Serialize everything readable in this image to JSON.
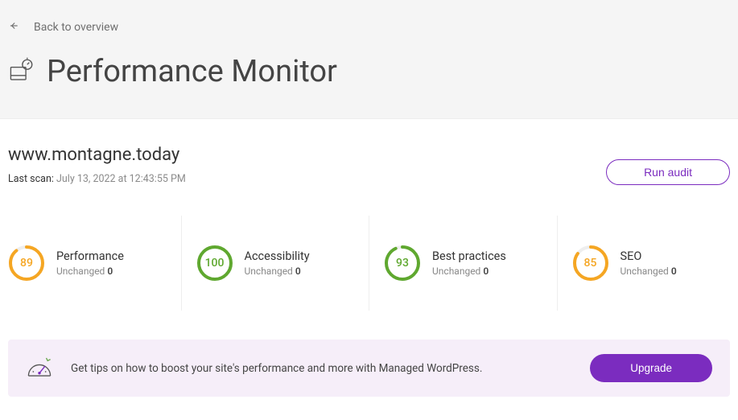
{
  "nav": {
    "back_label": "Back to overview"
  },
  "page_title": "Performance Monitor",
  "site": {
    "name": "www.montagne.today",
    "last_scan_label": "Last scan:",
    "last_scan_value": "July 13, 2022 at 12:43:55 PM",
    "run_audit_label": "Run audit"
  },
  "metrics": [
    {
      "name": "Performance",
      "score": 89,
      "delta_label": "Unchanged",
      "delta_value": 0,
      "color": "orange"
    },
    {
      "name": "Accessibility",
      "score": 100,
      "delta_label": "Unchanged",
      "delta_value": 0,
      "color": "green"
    },
    {
      "name": "Best practices",
      "score": 93,
      "delta_label": "Unchanged",
      "delta_value": 0,
      "color": "green"
    },
    {
      "name": "SEO",
      "score": 85,
      "delta_label": "Unchanged",
      "delta_value": 0,
      "color": "orange"
    }
  ],
  "upsell": {
    "text": "Get tips on how to boost your site's performance and more with Managed WordPress.",
    "cta": "Upgrade"
  }
}
